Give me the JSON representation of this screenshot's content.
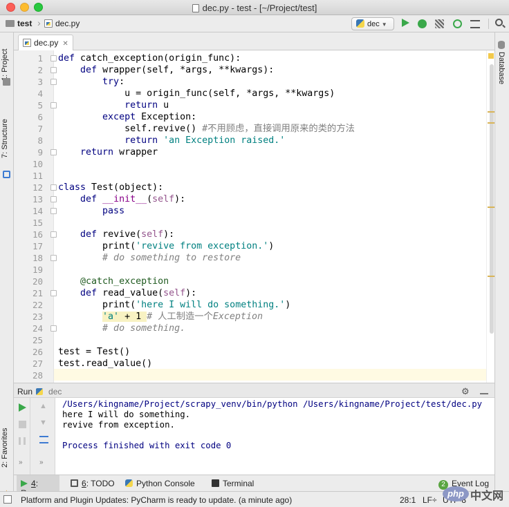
{
  "window": {
    "title": "dec.py - test - [~/Project/test]"
  },
  "navbar": {
    "project": "test",
    "file": "dec.py",
    "run_config": "dec"
  },
  "left_strip": {
    "project": "1: Project",
    "structure": "7: Structure",
    "favorites": "2: Favorites"
  },
  "right_strip": {
    "database": "Database"
  },
  "editor": {
    "tab": "dec.py",
    "line_numbers": [
      "1",
      "2",
      "3",
      "4",
      "5",
      "6",
      "7",
      "8",
      "9",
      "10",
      "11",
      "12",
      "13",
      "14",
      "15",
      "16",
      "17",
      "18",
      "19",
      "20",
      "21",
      "22",
      "23",
      "24",
      "25",
      "26",
      "27",
      "28"
    ],
    "code": {
      "l1_def": "def",
      "l1_rest": " catch_exception(origin_func):",
      "l2_def": "def",
      "l2_rest": " wrapper(self, *args, **kwargs):",
      "l3_try": "try",
      "l3_colon": ":",
      "l4": "u = origin_func(self, *args, **kwargs)",
      "l5_return": "return",
      "l5_rest": " u",
      "l6_except": "except",
      "l6_rest": " Exception:",
      "l7_code": "self.revive() ",
      "l7_comment": "#不用顾虑，直接调用原来的类的方法",
      "l8_return": "return",
      "l8_str": "'an Exception raised.'",
      "l9_return": "return",
      "l9_rest": " wrapper",
      "l12_class": "class",
      "l12_rest": " Test(object):",
      "l13_def": "def",
      "l13_init": "__init__",
      "l13_open": "(",
      "l13_self": "self",
      "l13_close": "):",
      "l14": "pass",
      "l16_def": "def",
      "l16_name": " revive(",
      "l16_self": "self",
      "l16_close": "):",
      "l17_print": "print(",
      "l17_str": "'revive from exception.'",
      "l17_close": ")",
      "l18_comment": "# do something to restore",
      "l20_deco": "@catch_exception",
      "l21_def": "def",
      "l21_name": " read_value(",
      "l21_self": "self",
      "l21_close": "):",
      "l22_print": "print(",
      "l22_str": "'here I will do something.'",
      "l22_close": ")",
      "l23_str": "'a'",
      "l23_op": " + 1 ",
      "l23_comment_hash": "# 人工制造一个",
      "l23_comment_word": "Exception",
      "l24_comment": "# do something.",
      "l26": "test = Test()",
      "l27": "test.read_value()"
    }
  },
  "run_panel": {
    "label": "Run",
    "config": "dec",
    "output": [
      "/Users/kingname/Project/scrapy_venv/bin/python /Users/kingname/Project/test/dec.py",
      "here I will do something.",
      "revive from exception.",
      "",
      "Process finished with exit code 0"
    ]
  },
  "tool_tabs": {
    "run_num": "4",
    "run": ": Run",
    "todo_num": "6",
    "todo": ": TODO",
    "python_console": "Python Console",
    "terminal": "Terminal",
    "event_count": "2",
    "event_log": "Event Log"
  },
  "status": {
    "message": "Platform and Plugin Updates: PyCharm is ready to update. (a minute ago)",
    "position": "28:1",
    "line_sep": "LF÷",
    "encoding": "UTF-8"
  },
  "watermark": {
    "php": "php",
    "site": "中文网"
  },
  "colors": {
    "keyword": "#000080",
    "string": "#008080",
    "comment": "#808080",
    "self": "#94558d",
    "run_green": "#3aa84a"
  }
}
